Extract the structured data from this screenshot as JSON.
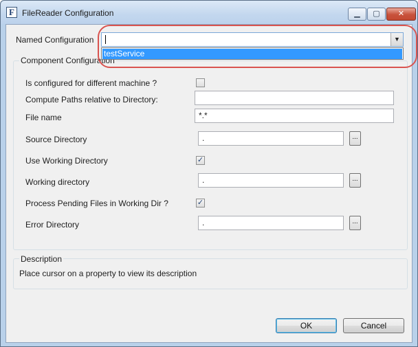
{
  "window": {
    "title": "FileReader Configuration",
    "icon_letter": "F",
    "min_glyph": "▁",
    "max_glyph": "▢",
    "close_glyph": "✕"
  },
  "named_configuration": {
    "label": "Named Configuration",
    "value": "",
    "options": [
      "testService"
    ],
    "dropdown_glyph": "▼"
  },
  "component_configuration": {
    "title": "Component Configuration",
    "fields": {
      "configured_different_machine": {
        "label": "Is configured for different machine ?",
        "checked": false
      },
      "compute_paths": {
        "label": "Compute Paths relative to Directory:",
        "value": ""
      },
      "file_name": {
        "label": "File name",
        "value": "*.*"
      },
      "source_directory": {
        "label": "Source Directory",
        "value": ".",
        "browse": "..."
      },
      "use_working_directory": {
        "label": "Use Working Directory",
        "checked": true
      },
      "working_directory": {
        "label": "Working directory",
        "value": ".",
        "browse": "..."
      },
      "process_pending": {
        "label": "Process Pending Files in Working Dir ?",
        "checked": true
      },
      "error_directory": {
        "label": "Error Directory",
        "value": ".",
        "browse": "..."
      }
    }
  },
  "description": {
    "title": "Description",
    "text": "Place cursor on a property to view its description"
  },
  "buttons": {
    "ok": "OK",
    "cancel": "Cancel"
  },
  "check_glyph": "✓"
}
